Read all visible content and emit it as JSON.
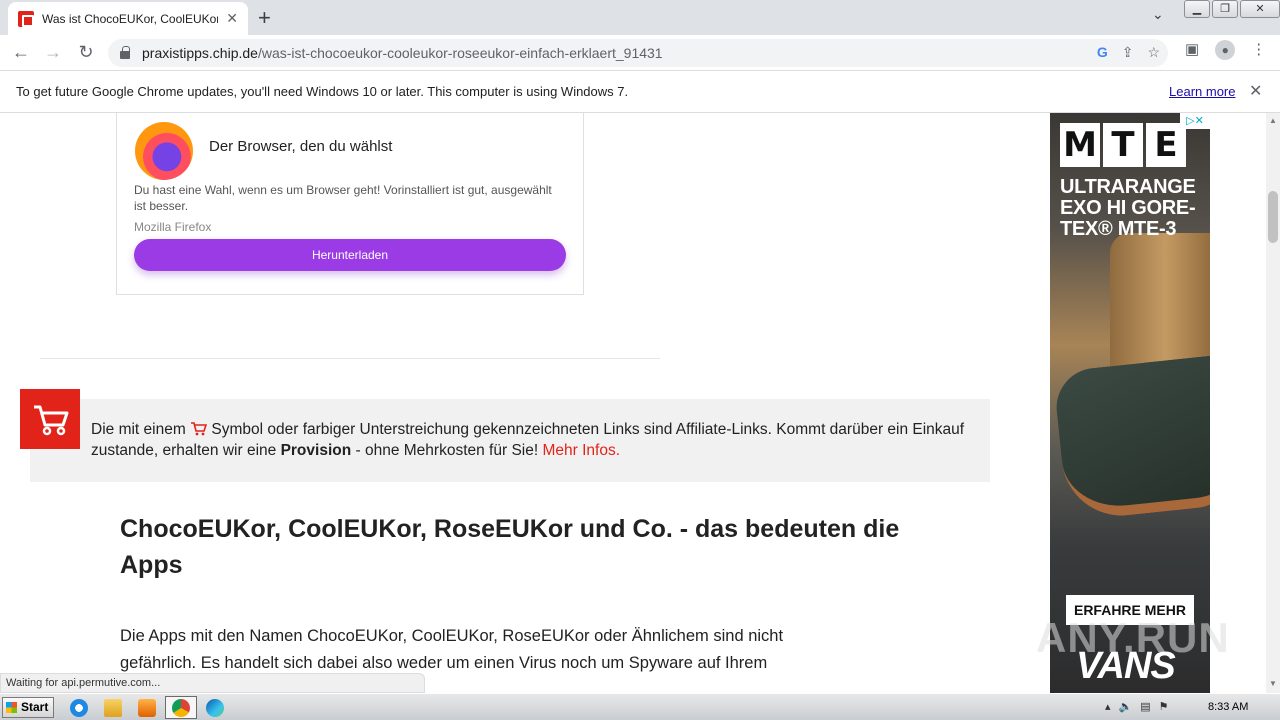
{
  "browser": {
    "tab_title": "Was ist ChocoEUKor, CoolEUKor, Ro",
    "tab_close": "✕",
    "new_tab": "+",
    "url_host": "praxistipps.chip.de",
    "url_path": "/was-ist-chocoeukor-cooleukor-roseeukor-einfach-erklaert_91431",
    "infobar_message": "To get future Google Chrome updates, you'll need Windows 10 or later. This computer is using Windows 7.",
    "infobar_link": "Learn more",
    "status_text": "Waiting for api.permutive.com..."
  },
  "firefox_card": {
    "heading": "Der Browser, den du wählst",
    "description": "Du hast eine Wahl, wenn es um Browser geht! Vorinstalliert ist gut, ausgewählt ist besser.",
    "source": "Mozilla Firefox",
    "button": "Herunterladen"
  },
  "affiliate": {
    "text_before": "Die mit einem ",
    "text_mid": " Symbol oder farbiger Unterstreichung gekennzeichneten Links sind Affiliate-Links. Kommt darüber ein Einkauf zustande, erhalten wir eine ",
    "bold": "Provision",
    "text_after": " - ohne Mehrkosten für Sie! ",
    "link": "Mehr Infos."
  },
  "article": {
    "heading": "ChocoEUKor, CoolEUKor, RoseEUKor und Co. - das bedeuten die Apps",
    "paragraph": "Die Apps mit den Namen ChocoEUKor, CoolEUKor, RoseEUKor oder Ähnlichem sind nicht gefährlich. Es handelt sich dabei also weder um einen Virus noch um Spyware auf Ihrem"
  },
  "ad": {
    "brand_letters": [
      "M",
      "T",
      "E"
    ],
    "tagline": "ULTRARANGE EXO HI GORE-TEX® MTE-3",
    "cta": "ERFAHRE MEHR",
    "brand": "VANS",
    "adchoices": "▷✕"
  },
  "watermark": "ANY.RUN",
  "taskbar": {
    "start": "Start",
    "time": "8:33 AM"
  }
}
